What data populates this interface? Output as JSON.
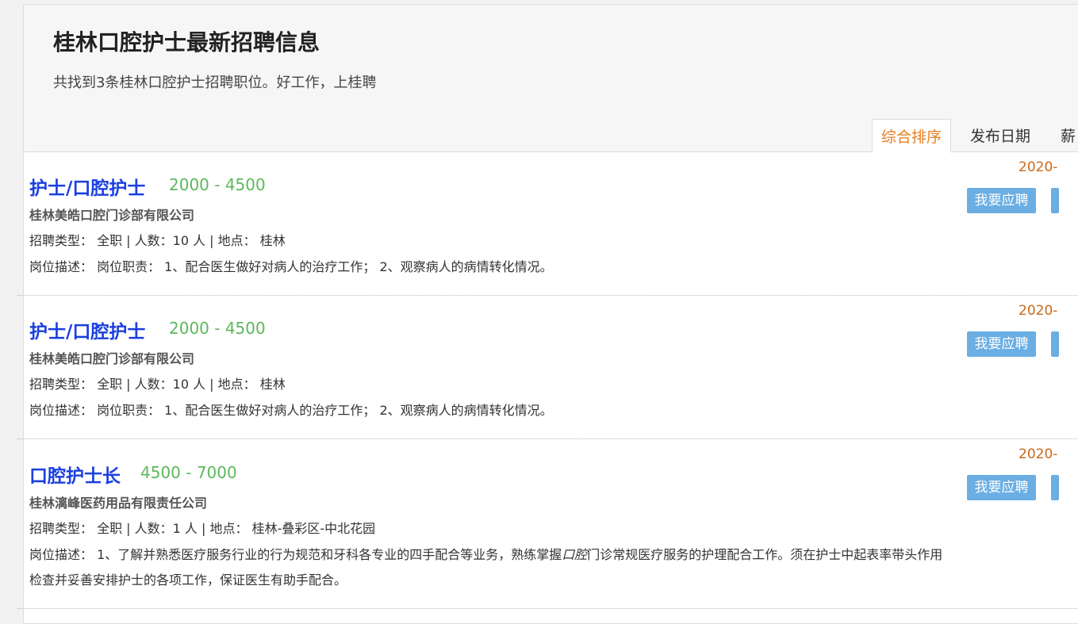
{
  "header": {
    "title": "桂林口腔护士最新招聘信息",
    "subtitle": "共找到3条桂林口腔护士招聘职位。好工作，上桂聘"
  },
  "sort_tabs": [
    "综合排序",
    "发布日期",
    "薪"
  ],
  "apply_label": "我要应聘",
  "jobs": [
    {
      "title": "护士/口腔护士",
      "salary": "2000 - 4500",
      "company": "桂林美皓口腔门诊部有限公司",
      "meta": "招聘类型：  全职 | 人数：10 人 | 地点：  桂林",
      "desc": "岗位描述：  岗位职责：  1、配合医生做好对病人的治疗工作；  2、观察病人的病情转化情况。",
      "date": "2020-"
    },
    {
      "title": "护士/口腔护士",
      "salary": "2000 - 4500",
      "company": "桂林美皓口腔门诊部有限公司",
      "meta": "招聘类型：  全职 | 人数：10 人 | 地点：  桂林",
      "desc": "岗位描述：  岗位职责：  1、配合医生做好对病人的治疗工作；  2、观察病人的病情转化情况。",
      "date": "2020-"
    },
    {
      "title": "口腔护士长",
      "salary": "4500 - 7000",
      "company": "桂林漓峰医药用品有限责任公司",
      "meta": "招聘类型：  全职 | 人数：1 人 | 地点：  桂林-叠彩区-中北花园",
      "desc_before": "岗位描述：  1、了解并熟悉医疗服务行业的行为规范和牙科各专业的四手配合等业务，熟练掌握",
      "desc_em": "口腔",
      "desc_after": "门诊常规医疗服务的护理配合工作。须在护士中起表率带头作用",
      "desc_line2": "检查并妥善安排护士的各项工作，保证医生有助手配合。",
      "date": "2020-"
    }
  ]
}
